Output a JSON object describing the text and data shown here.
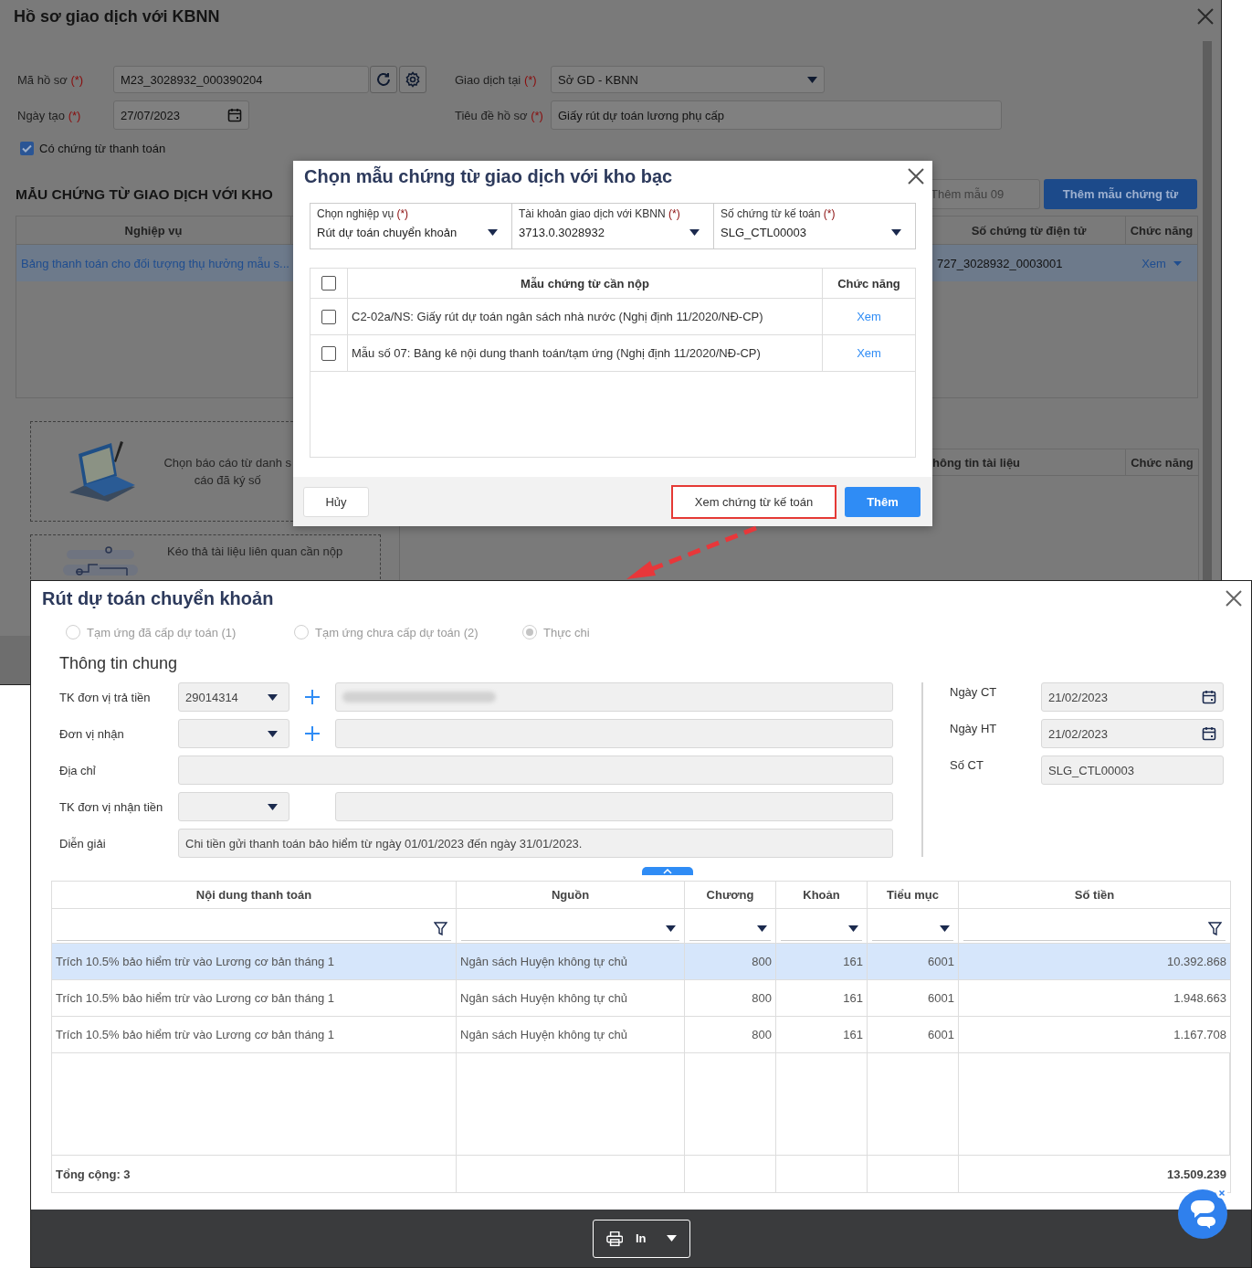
{
  "back_window": {
    "title": "Hồ sơ giao dịch với KBNN",
    "ma_ho_so": {
      "label": "Mã hồ sơ",
      "required_mark": "(*)",
      "value": "M23_3028932_000390204"
    },
    "giao_dich_tai": {
      "label": "Giao dịch tại",
      "required_mark": "(*)",
      "value": "Sở GD - KBNN"
    },
    "ngay_tao": {
      "label": "Ngày tạo",
      "required_mark": "(*)",
      "value": "27/07/2023"
    },
    "tieu_de": {
      "label": "Tiêu đề hồ sơ",
      "required_mark": "(*)",
      "value": "Giấy rút dự toán lương phụ cấp"
    },
    "payment_checkbox": {
      "label": "Có chứng từ thanh toán",
      "checked": true
    },
    "section_title": "MẪU CHỨNG TỪ GIAO DỊCH VỚI KHO",
    "template_field": {
      "placeholder": "Thêm mẫu 09"
    },
    "add_template_button": "Thêm mẫu chứng từ",
    "templates_table": {
      "columns": [
        "Nghiệp vụ",
        "Số chứng từ điện tử",
        "Chức năng"
      ],
      "rows": [
        {
          "nghiep_vu": "Bảng thanh toán cho đối tượng thụ hưởng mẫu s...",
          "so_chung_tu": "727_3028932_0003001",
          "action": "Xem",
          "selected": true
        }
      ]
    },
    "upload_boxes": [
      {
        "kind": "laptop",
        "lines": [
          "Chọn báo cáo từ danh s",
          "cáo đã ký số"
        ]
      },
      {
        "kind": "drag",
        "lines": [
          "Kéo thả tài liệu liên quan cần nộp"
        ]
      }
    ],
    "documents_table": {
      "columns": [
        "hông tin tài liệu",
        "Chức năng"
      ]
    }
  },
  "modal": {
    "title": "Chọn mẫu chứng từ giao dịch với kho bạc",
    "selects": [
      {
        "label": "Chọn nghiệp vụ",
        "required_mark": "(*)",
        "value": "Rút dự toán chuyển khoản"
      },
      {
        "label": "Tài khoản giao dịch với KBNN",
        "required_mark": "(*)",
        "value": "3713.0.3028932"
      },
      {
        "label": "Số chứng từ kế toán",
        "required_mark": "(*)",
        "value": "SLG_CTL00003"
      }
    ],
    "table": {
      "select_all_checked": false,
      "columns": [
        "Mẫu chứng từ cần nộp",
        "Chức năng"
      ],
      "rows": [
        {
          "checked": false,
          "name": "C2-02a/NS: Giấy rút dự toán ngân sách nhà nước (Nghị định 11/2020/NĐ-CP)",
          "action": "Xem"
        },
        {
          "checked": false,
          "name": "Mẫu số 07: Bảng kê nội dung thanh toán/tạm ứng (Nghị định 11/2020/NĐ-CP)",
          "action": "Xem"
        }
      ]
    },
    "buttons": [
      {
        "label": "Hủy",
        "kind": "secondary"
      },
      {
        "label": "Xem chứng từ kế toán",
        "kind": "highlighted"
      },
      {
        "label": "Thêm",
        "kind": "primary"
      }
    ]
  },
  "voucher_window": {
    "title": "Rút dự toán chuyển khoản",
    "voucher_types": [
      {
        "label": "Tạm ứng đã cấp dự toán (1)",
        "selected": false
      },
      {
        "label": "Tạm ứng chưa cấp dự toán (2)",
        "selected": false
      },
      {
        "label": "Thực chi",
        "selected": true
      }
    ],
    "section_title": "Thông tin chung",
    "left_fields": [
      {
        "label": "TK đơn vị trả tiền",
        "kind": "select_add",
        "value": "29014314",
        "detail_redacted": true
      },
      {
        "label": "Đơn vị nhận",
        "kind": "select_add",
        "detail_redacted": false
      },
      {
        "label": "Địa chỉ",
        "kind": "text"
      },
      {
        "label": "TK đơn vị nhận tiền",
        "kind": "select",
        "detail_redacted": false
      },
      {
        "label": "Diễn giải",
        "kind": "text",
        "value": "Chi tiền gửi thanh toán bảo hiểm từ ngày 01/01/2023 đến ngày 31/01/2023."
      }
    ],
    "right_fields": [
      {
        "label": "Ngày CT",
        "kind": "date",
        "value": "21/02/2023"
      },
      {
        "label": "Ngày HT",
        "kind": "date",
        "value": "21/02/2023"
      },
      {
        "label": "Số CT",
        "kind": "text",
        "value": "SLG_CTL00003"
      }
    ],
    "table": {
      "columns": [
        {
          "label": "Nội dung thanh toán",
          "kind": "text"
        },
        {
          "label": "Nguồn",
          "kind": "select"
        },
        {
          "label": "Chương",
          "kind": "code"
        },
        {
          "label": "Khoản",
          "kind": "code"
        },
        {
          "label": "Tiểu mục",
          "kind": "code"
        },
        {
          "label": "Số tiền",
          "kind": "amount"
        }
      ],
      "rows": [
        {
          "selected": true,
          "cells": [
            "Trích 10.5% bảo hiểm trừ vào Lương cơ bản tháng 1",
            "Ngân sách Huyện không tự chủ",
            "800",
            "161",
            "6001",
            "10.392.868"
          ]
        },
        {
          "selected": false,
          "cells": [
            "Trích 10.5% bảo hiểm trừ vào Lương cơ bản tháng 1",
            "Ngân sách Huyện không tự chủ",
            "800",
            "161",
            "6001",
            "1.948.663"
          ]
        },
        {
          "selected": false,
          "cells": [
            "Trích 10.5% bảo hiểm trừ vào Lương cơ bản tháng 1",
            "Ngân sách Huyện không tự chủ",
            "800",
            "161",
            "6001",
            "1.167.708"
          ]
        }
      ],
      "footer": {
        "label": "Tổng cộng: 3",
        "total": "13.509.239"
      }
    },
    "print_button": "In"
  }
}
